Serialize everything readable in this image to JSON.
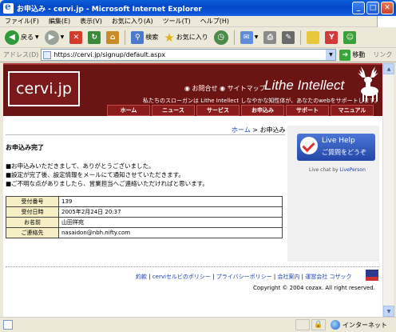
{
  "window": {
    "title": "お申込み - cervi.jp - Microsoft Internet Explorer",
    "buttons": {
      "minimize": "_",
      "maximize": "□",
      "close": "✕"
    }
  },
  "menu": [
    "ファイル(F)",
    "編集(E)",
    "表示(V)",
    "お気に入り(A)",
    "ツール(T)",
    "ヘルプ(H)"
  ],
  "toolbar": {
    "back_label": "戻る",
    "search_label": "検索",
    "favorites_label": "お気に入り"
  },
  "address": {
    "label": "アドレス(D)",
    "url": "https://cervi.jp/signup/default.aspx",
    "go_label": "移動",
    "links_label": "リンク"
  },
  "site": {
    "logo": "cervi.jp",
    "header_links": "◉ お問合せ ◉ サイトマップ",
    "brand": "Lithe Intellect",
    "slogan": "私たちのスローガンは Lithe Intellect しなやかな知性体が、あなたのwebをサポートします。",
    "nav": [
      "ホーム",
      "ニュース",
      "サービス",
      "お申込み",
      "サポート",
      "マニュアル"
    ]
  },
  "breadcrumb": {
    "home": "ホーム",
    "sep": " > ",
    "current": "お申込み"
  },
  "main": {
    "title": "お申込み完了",
    "messages": [
      "■お申込みいただきまして、ありがとうございました。",
      "■設定が完了後、設定情報をメールにて通知させていただきます。",
      "■ご不明な点がありましたら、営業担当へご連絡いただければと思います。"
    ],
    "table": [
      {
        "key": "受付番号",
        "value": "139"
      },
      {
        "key": "受付日時",
        "value": "2005年2月24日 20:37"
      },
      {
        "key": "お名前",
        "value": "山田祥宛"
      },
      {
        "key": "ご連絡先",
        "value": "nasaidon@nbh.nifty.com"
      }
    ]
  },
  "sidebar": {
    "livehelp_title": "Live Help",
    "livehelp_sub": "ご質問をどうぞ",
    "livechat_prefix": "Live chat by ",
    "livechat_brand": "LivePerson"
  },
  "footer": {
    "links": [
      "約款",
      "cerviセルビのポリシー",
      "プライバシーポリシー",
      "会社案内",
      "運営会社 コザック"
    ],
    "copyright": "Copyright © 2004 cozax. All right reserved."
  },
  "status": {
    "zone": "インターネット"
  },
  "colors": {
    "header": "#6b1414",
    "nav": "#8a1c1c",
    "link": "#1a3fb0",
    "table_key": "#f6efc6"
  }
}
